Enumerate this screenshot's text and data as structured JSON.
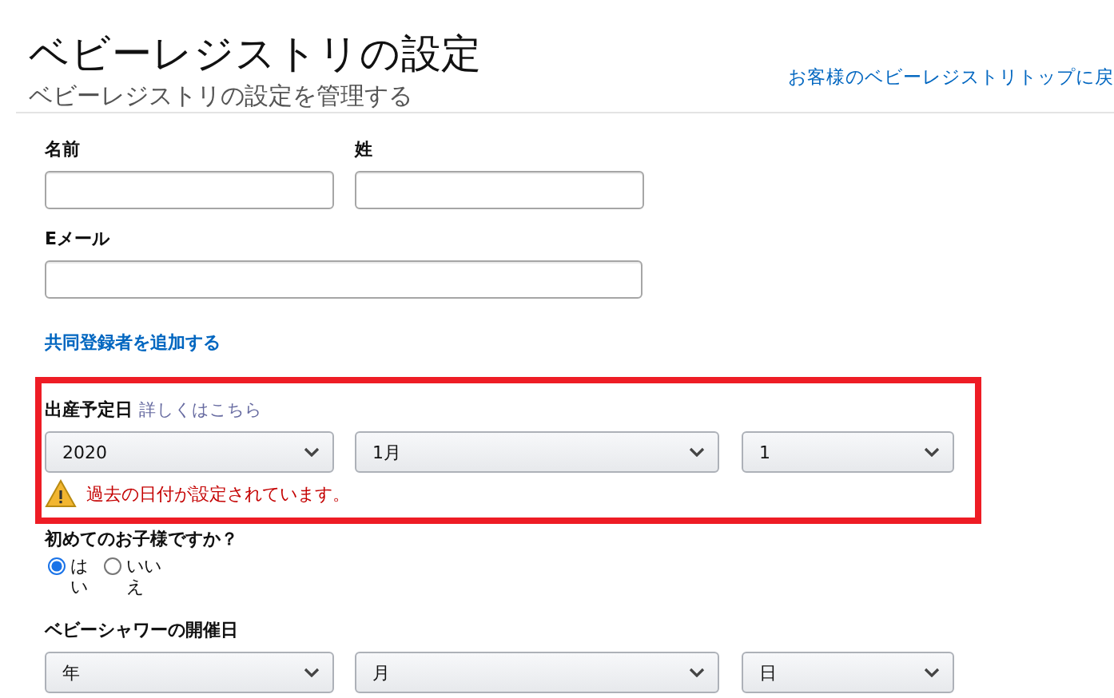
{
  "header": {
    "title": "ベビーレジストリの設定",
    "subtitle": "ベビーレジストリの設定を管理する",
    "back_link": "お客様のベビーレジストリトップに戻"
  },
  "name_fields": [
    {
      "label": "名前"
    },
    {
      "label": "姓"
    }
  ],
  "email": {
    "label": "Eメール"
  },
  "add_coregistrant_link": "共同登録者を追加する",
  "due_date": {
    "label": "出産予定日",
    "help_link": "詳しくはこちら",
    "selects": [
      "2020",
      "1月",
      "1"
    ],
    "warning": "過去の日付が設定されています。"
  },
  "first_child": {
    "label": "初めてのお子様ですか？",
    "options": [
      {
        "label": "はい",
        "selected": true
      },
      {
        "label": "いいえ",
        "selected": false
      }
    ]
  },
  "shower_date": {
    "label": "ベビーシャワーの開催日",
    "selects": [
      "年",
      "月",
      "日"
    ]
  }
}
